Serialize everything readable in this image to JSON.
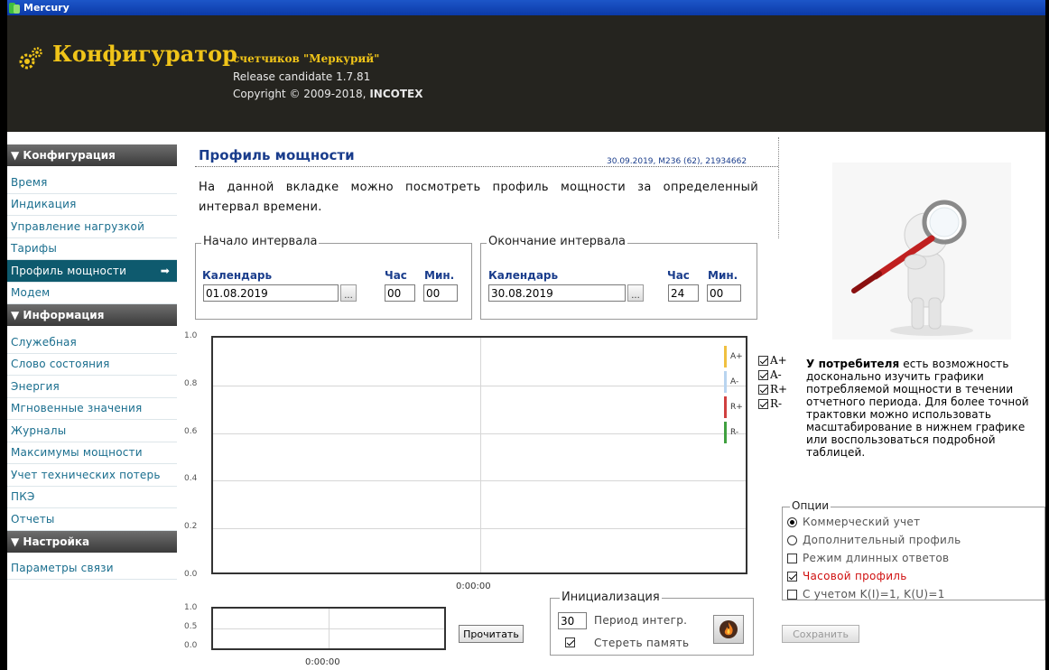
{
  "window": {
    "title": "Mercury"
  },
  "header": {
    "brand": "Конфигуратор",
    "brand_sub": "счетчиков \"Меркурий\"",
    "release": "Release candidate 1.7.81",
    "copyright_prefix": "Copyright © 2009-2018, ",
    "copyright_company": "INCOTEX"
  },
  "sidebar": {
    "sections": [
      {
        "title": "▼ Конфигурация",
        "items": [
          "Время",
          "Индикация",
          "Управление нагрузкой",
          "Тарифы",
          "Профиль мощности",
          "Модем"
        ]
      },
      {
        "title": "▼ Информация",
        "items": [
          "Служебная",
          "Слово состояния",
          "Энергия",
          "Мгновенные значения",
          "Журналы",
          "Максимумы мощности",
          "Учет технических потерь",
          "ПКЭ",
          "Отчеты"
        ]
      },
      {
        "title": "▼ Настройка",
        "items": [
          "Параметры связи"
        ]
      }
    ],
    "active_item": "Профиль мощности",
    "active_arrow": "➡"
  },
  "page": {
    "title": "Профиль мощности",
    "meta": "30.09.2019, M236 (62), 21934662",
    "description": "На данной вкладке можно посмотреть профиль мощности за определенный интервал времени."
  },
  "interval_start": {
    "legend": "Начало интервала",
    "calendar_label": "Календарь",
    "hour_label": "Час",
    "min_label": "Мин.",
    "date": "01.08.2019",
    "hour": "00",
    "min": "00",
    "picker": "..."
  },
  "interval_end": {
    "legend": "Окончание интервала",
    "calendar_label": "Календарь",
    "hour_label": "Час",
    "min_label": "Мин.",
    "date": "30.08.2019",
    "hour": "24",
    "min": "00",
    "picker": "..."
  },
  "chart_data": {
    "type": "line",
    "x": [],
    "series": [
      {
        "name": "A+",
        "values": [],
        "color": "#f0c040"
      },
      {
        "name": "A-",
        "values": [],
        "color": "#b8d4f0"
      },
      {
        "name": "R+",
        "values": [],
        "color": "#d04040"
      },
      {
        "name": "R-",
        "values": [],
        "color": "#40a040"
      }
    ],
    "yticks": [
      "1.0",
      "0.8",
      "0.6",
      "0.4",
      "0.2",
      "0.0"
    ],
    "xticks": [
      "0:00:00"
    ],
    "ylim": [
      0,
      1
    ],
    "grid": true,
    "legend": "top-right"
  },
  "mini_chart": {
    "yticks": [
      "1.0",
      "0.5",
      "0.0"
    ],
    "xticks": [
      "0:00:00"
    ]
  },
  "series_toggles": [
    {
      "label": "A+",
      "checked": true
    },
    {
      "label": "A-",
      "checked": true
    },
    {
      "label": "R+",
      "checked": true
    },
    {
      "label": "R-",
      "checked": true
    }
  ],
  "read_button": "Прочитать",
  "init": {
    "legend": "Инициализация",
    "period_value": "30",
    "period_label": "Период интегр.",
    "erase_label": "Стереть память",
    "erase_checked": true
  },
  "info": {
    "bold": "У потребителя",
    "text": " есть возможность досконально изучить графики потребляемой мощности в течении отчетного периода. Для более точной трактовки можно использовать масштабирование в нижнем графике или воспользоваться подробной таблицей."
  },
  "options": {
    "legend": "Опции",
    "items": [
      {
        "type": "radio",
        "label": "Коммерческий учет",
        "checked": true
      },
      {
        "type": "radio",
        "label": "Дополнительный профиль",
        "checked": false
      },
      {
        "type": "checkbox",
        "label": "Режим длинных ответов",
        "checked": false
      },
      {
        "type": "checkbox",
        "label": "Часовой профиль",
        "checked": true,
        "highlight": "#d01010"
      },
      {
        "type": "checkbox",
        "label": "С учетом K(I)=1, K(U)=1",
        "checked": false
      }
    ]
  },
  "save_button": "Сохранить"
}
